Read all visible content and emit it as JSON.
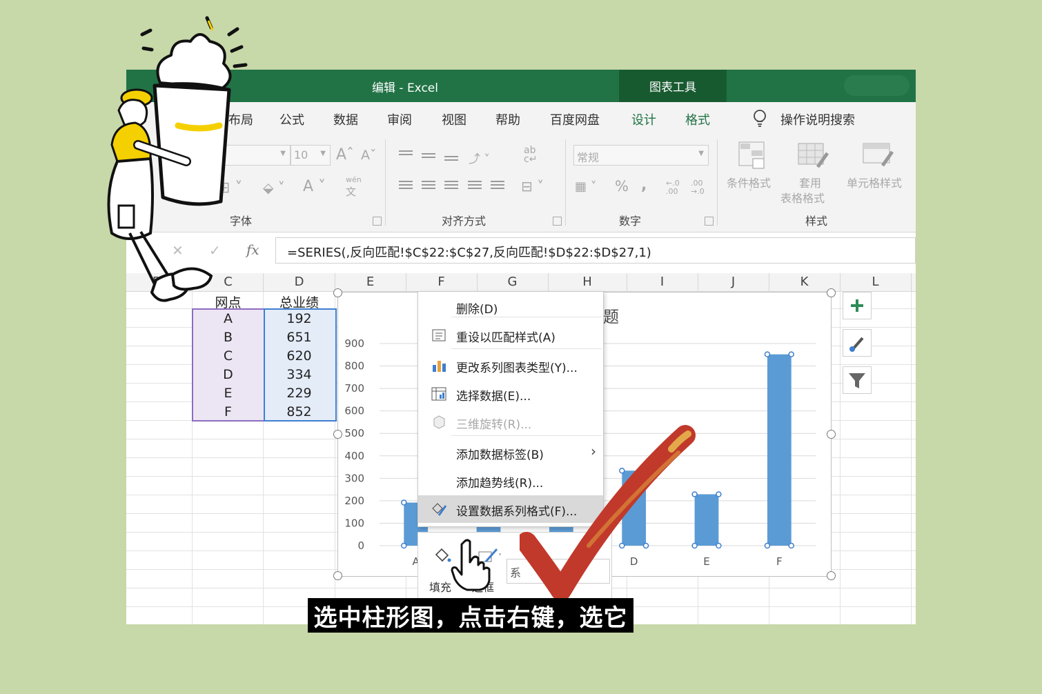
{
  "titlebar": {
    "title": "编辑  -  Excel",
    "chart_tools": "图表工具"
  },
  "ribbon_tabs": [
    "布局",
    "公式",
    "数据",
    "审阅",
    "视图",
    "帮助",
    "百度网盘",
    "设计",
    "格式"
  ],
  "search": {
    "label": "操作说明搜索"
  },
  "ribbon": {
    "font_size": "10",
    "number_format": "常规",
    "groups": {
      "font": "字体",
      "alignment": "对齐方式",
      "number": "数字",
      "styles": "样式"
    },
    "styles": {
      "conditional": "条件格式",
      "table_1": "套用",
      "table_2": "表格格式",
      "cell": "单元格样式"
    },
    "wen": "wén",
    "wen_char": "文",
    "ab": "ab",
    "percent": "%",
    "comma": ",",
    "dec_inc": "←.0 .00",
    "dec_dec": ".00 →.0"
  },
  "formula_bar": {
    "x": "✕",
    "check": "✓",
    "fx": "fx",
    "formula": "=SERIES(,反向匹配!$C$22:$C$27,反向匹配!$D$22:$D$27,1)"
  },
  "columns": [
    "B",
    "C",
    "D",
    "E",
    "F",
    "G",
    "H",
    "I",
    "J",
    "K",
    "L"
  ],
  "table": {
    "header_c": "网点",
    "header_d": "总业绩",
    "rows": [
      {
        "c": "A",
        "d": "192"
      },
      {
        "c": "B",
        "d": "651"
      },
      {
        "c": "C",
        "d": "620"
      },
      {
        "c": "D",
        "d": "334"
      },
      {
        "c": "E",
        "d": "229"
      },
      {
        "c": "F",
        "d": "852"
      }
    ]
  },
  "chart_title_fragment": "题",
  "chart_data": {
    "type": "bar",
    "categories": [
      "A",
      "B",
      "C",
      "D",
      "E",
      "F"
    ],
    "values": [
      192,
      651,
      620,
      334,
      229,
      852
    ],
    "ylim": [
      0,
      900
    ],
    "yticks": [
      0,
      100,
      200,
      300,
      400,
      500,
      600,
      700,
      800,
      900
    ],
    "bar_color": "#5b9bd5",
    "grid": true
  },
  "context_menu": [
    {
      "label": "删除(D)",
      "icon": "none"
    },
    {
      "label": "重设以匹配样式(A)",
      "icon": "reset-style-icon"
    },
    {
      "label": "更改系列图表类型(Y)...",
      "icon": "chart-type-icon"
    },
    {
      "label": "选择数据(E)...",
      "icon": "select-data-icon"
    },
    {
      "label": "三维旋转(R)...",
      "icon": "3d-rotation-icon",
      "disabled": true
    },
    {
      "label": "添加数据标签(B)",
      "icon": "none",
      "submenu": true
    },
    {
      "label": "添加趋势线(R)...",
      "icon": "none"
    },
    {
      "label": "设置数据系列格式(F)...",
      "icon": "format-series-icon",
      "highlighted": true
    }
  ],
  "mini_toolbar": {
    "fill": "填充",
    "outline": "边框",
    "series": "系"
  },
  "caption": "选中柱形图，点击右键，选它",
  "colors": {
    "excel_green": "#217346",
    "background": "#c7d8a9",
    "checkmark": "#c0392b"
  }
}
